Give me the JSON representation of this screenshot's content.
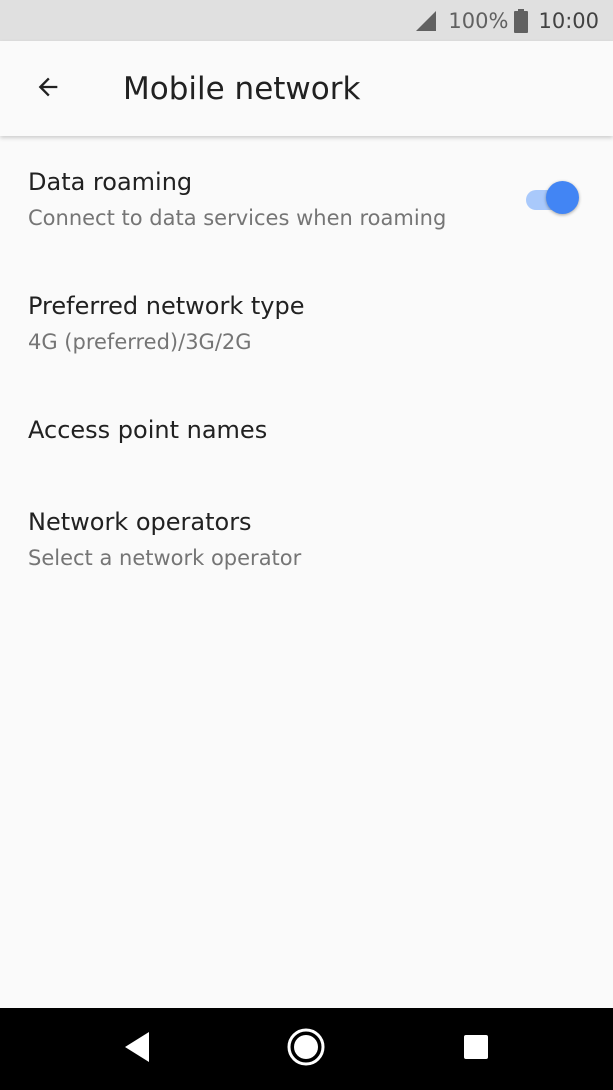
{
  "status_bar": {
    "battery_percent": "100%",
    "time": "10:00",
    "icons": [
      "signal-icon",
      "battery-icon"
    ]
  },
  "app_bar": {
    "title": "Mobile network",
    "back_icon": "arrow-back-icon"
  },
  "settings": [
    {
      "title": "Data roaming",
      "summary": "Connect to data services when roaming",
      "toggle_on": true
    },
    {
      "title": "Preferred network type",
      "summary": "4G (preferred)/3G/2G"
    },
    {
      "title": "Access point names"
    },
    {
      "title": "Network operators",
      "summary": "Select a network operator"
    }
  ],
  "nav_bar": {
    "icons": [
      "back-triangle-icon",
      "home-circle-icon",
      "recents-square-icon"
    ]
  },
  "colors": {
    "accent": "#4285f4",
    "accent_track": "#a9c9fb",
    "status_bar_bg": "#e0e0e0",
    "background": "#fafafa",
    "primary_text": "#212121",
    "secondary_text": "#757575",
    "nav_bar_bg": "#000000"
  }
}
